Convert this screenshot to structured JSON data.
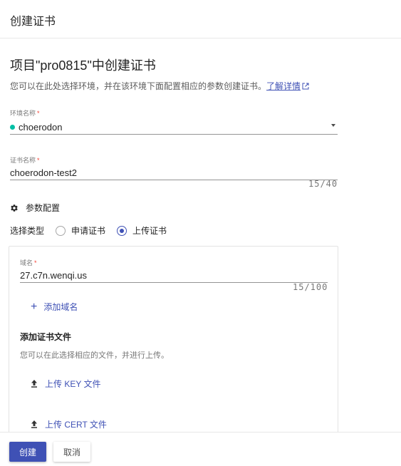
{
  "header": {
    "title": "创建证书"
  },
  "page": {
    "title": "项目\"pro0815\"中创建证书",
    "description": "您可以在此处选择环境，并在该环境下面配置相应的参数创建证书。",
    "learn_more": "了解详情"
  },
  "env_field": {
    "label": "环境名称",
    "required_mark": "*",
    "value": "choerodon",
    "status_color": "#00bfa5"
  },
  "cert_name_field": {
    "label": "证书名称",
    "required_mark": "*",
    "value": "choerodon-test2",
    "counter": "15/40"
  },
  "params": {
    "title": "参数配置",
    "icon": "gear-icon"
  },
  "cert_type": {
    "label": "选择类型",
    "options": [
      "申请证书",
      "上传证书"
    ],
    "selected": "上传证书"
  },
  "domain_field": {
    "label": "域名",
    "required_mark": "*",
    "value": "27.c7n.wenqi.us",
    "counter": "15/100"
  },
  "add_domain": {
    "label": "添加域名"
  },
  "upload": {
    "title": "添加证书文件",
    "description": "您可以在此选择相应的文件，并进行上传。",
    "key_label": "上传 KEY 文件",
    "cert_label": "上传 CERT 文件"
  },
  "footer": {
    "create_label": "创建",
    "cancel_label": "取消"
  },
  "colors": {
    "primary": "#3f51b5",
    "required": "#f44336"
  }
}
